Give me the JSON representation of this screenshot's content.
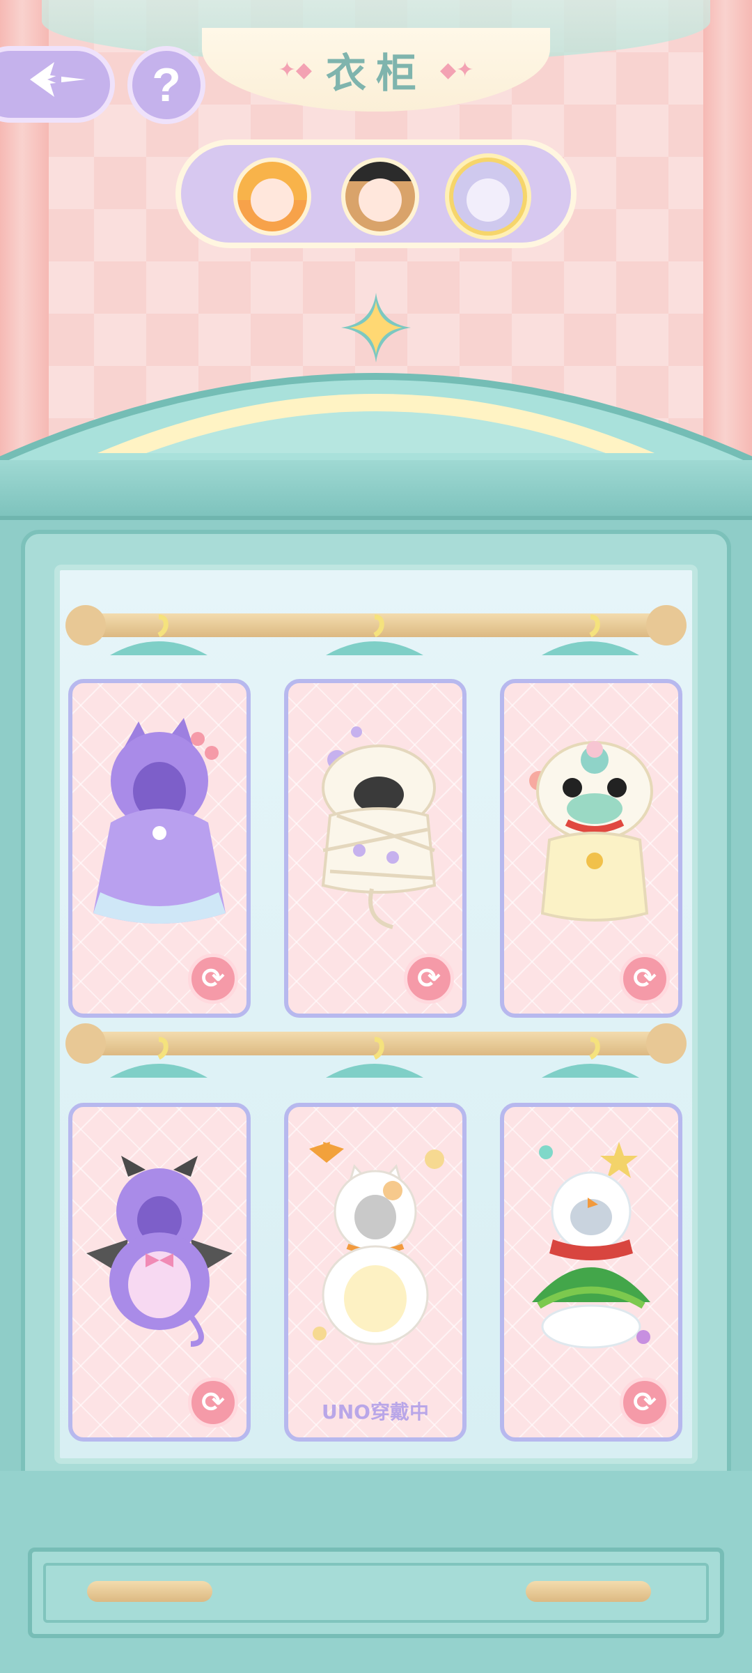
{
  "header": {
    "title": "衣柜",
    "back_icon": "sparkle-arrow-back-icon",
    "help_label": "?"
  },
  "characters": [
    {
      "name_icon": "avatar-blonde-girl",
      "selected": false
    },
    {
      "name_icon": "avatar-brown-hair-hat",
      "selected": false
    },
    {
      "name_icon": "avatar-silver-hair",
      "selected": true
    }
  ],
  "wardrobe": {
    "outfits": [
      {
        "name": "purple-cat-hoodie",
        "swap_icon": "refresh-icon",
        "wearing": false
      },
      {
        "name": "mummy-bandage",
        "swap_icon": "refresh-icon",
        "wearing": false
      },
      {
        "name": "lion-dance",
        "swap_icon": "refresh-icon",
        "wearing": false
      },
      {
        "name": "purple-devil",
        "swap_icon": "refresh-icon",
        "wearing": false
      },
      {
        "name": "white-cat",
        "swap_icon": "",
        "wearing": true,
        "wearing_label": "UNO穿戴中"
      },
      {
        "name": "christmas-tree-snowman",
        "swap_icon": "refresh-icon",
        "wearing": false
      }
    ]
  },
  "colors": {
    "accent_purple": "#c5b2ec",
    "card_pink": "#fde3e5",
    "wardrobe_teal": "#8fcdc8",
    "swap_pink": "#f59aa8"
  }
}
